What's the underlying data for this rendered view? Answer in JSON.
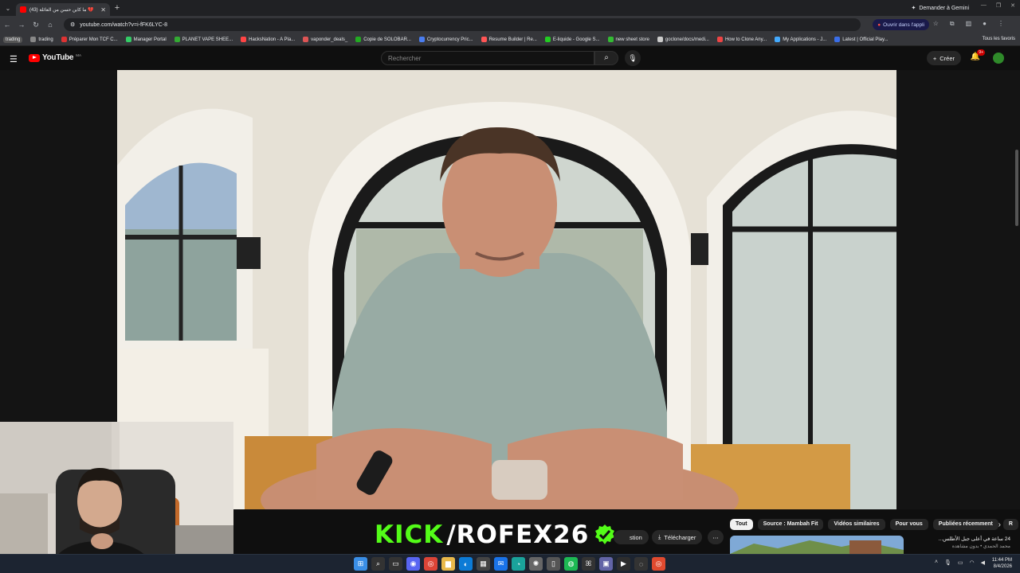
{
  "browser": {
    "tab_title": "(43) ما كاين حسن من العائلة 💔",
    "gemini_label": "Demander à Gemini",
    "url": "youtube.com/watch?v=i-fFK6LYC-8",
    "open_app_label": "Ouvrir dans l'appli",
    "bookmarks": [
      {
        "label": "trading"
      },
      {
        "label": "trading"
      },
      {
        "label": "Préparer Mon TCF C..."
      },
      {
        "label": "Manager Portal"
      },
      {
        "label": "PLANET VAPE SHEE..."
      },
      {
        "label": "HacksNation - A Pla..."
      },
      {
        "label": "vaponder_deals_"
      },
      {
        "label": "Copie de SOLOBAR..."
      },
      {
        "label": "Cryptocurrency Pric..."
      },
      {
        "label": "Resume Builder | Re..."
      },
      {
        "label": "E-liquide - Google S..."
      },
      {
        "label": "new sheet store"
      },
      {
        "label": "goclone/docs/medi..."
      },
      {
        "label": "How to Clone Any..."
      },
      {
        "label": "My Applications - J..."
      },
      {
        "label": "Latest | Official Play..."
      }
    ],
    "all_favorites_label": "Tous les favoris"
  },
  "youtube": {
    "logo_text": "YouTube",
    "country_code": "MA",
    "search_placeholder": "Rechercher",
    "create_label": "Créer",
    "notification_count": "9+"
  },
  "below_video": {
    "kick_left": "KICK",
    "kick_right": "/ROFEX26",
    "partial_label": "stion",
    "download_label": "Télécharger",
    "chips": [
      "Tout",
      "Source : Mambah Fit",
      "Vidéos similaires",
      "Pour vous",
      "Publiées récemment",
      "R"
    ],
    "rec_title": "24 ساعة في أعلى جبل الأطلس...",
    "rec_channel": "محمد الحمدي • بدون مشاهدة"
  },
  "taskbar": {
    "time": "11:44 PM",
    "date": "8/4/2026"
  },
  "colors": {
    "kick_green": "#53fc18",
    "yt_red": "#ff0000",
    "bg": "#0f0f0f"
  }
}
